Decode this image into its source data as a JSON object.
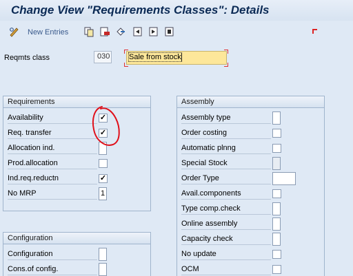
{
  "window": {
    "title": "Change View \"Requirements Classes\": Details"
  },
  "toolbar": {
    "new_entries_label": "New Entries",
    "icons": [
      "edit-glasses-icon",
      "copy-icon",
      "delete-icon",
      "undo-icon",
      "previous-entry-icon",
      "next-entry-icon",
      "select-block-icon"
    ]
  },
  "header": {
    "reqmts_class_label": "Reqmts class",
    "reqmts_class_value": "030",
    "description_value": "Sale from stock"
  },
  "requirements": {
    "title": "Requirements",
    "items": [
      {
        "label": "Availability",
        "type": "checkbox",
        "value": "✓"
      },
      {
        "label": "Req. transfer",
        "type": "checkbox",
        "value": "✓"
      },
      {
        "label": "Allocation ind.",
        "type": "box",
        "value": ""
      },
      {
        "label": "Prod.allocation",
        "type": "checkbox",
        "value": ""
      },
      {
        "label": "Ind.req.reductn",
        "type": "checkbox",
        "value": "✓"
      },
      {
        "label": "No MRP",
        "type": "box",
        "value": "1"
      }
    ]
  },
  "configuration": {
    "title": "Configuration",
    "items": [
      {
        "label": "Configuration",
        "type": "box",
        "value": ""
      },
      {
        "label": "Cons.of config.",
        "type": "box",
        "value": ""
      }
    ]
  },
  "assembly": {
    "title": "Assembly",
    "items": [
      {
        "label": "Assembly type",
        "type": "box",
        "value": ""
      },
      {
        "label": "Order costing",
        "type": "checkbox",
        "value": ""
      },
      {
        "label": "Automatic plnng",
        "type": "checkbox",
        "value": ""
      },
      {
        "label": "Special Stock",
        "type": "box-gray",
        "value": ""
      },
      {
        "label": "Order Type",
        "type": "wide",
        "value": ""
      },
      {
        "label": "Avail.components",
        "type": "checkbox",
        "value": ""
      },
      {
        "label": "Type comp.check",
        "type": "box",
        "value": ""
      },
      {
        "label": "Online assembly",
        "type": "box",
        "value": ""
      },
      {
        "label": "Capacity check",
        "type": "box",
        "value": ""
      },
      {
        "label": "No update",
        "type": "checkbox",
        "value": ""
      },
      {
        "label": "OCM",
        "type": "checkbox",
        "value": ""
      }
    ]
  },
  "colors": {
    "background": "#dfe9f5",
    "title": "#0b2a55",
    "highlight": "#fde79a",
    "annotation": "#e0101a"
  }
}
